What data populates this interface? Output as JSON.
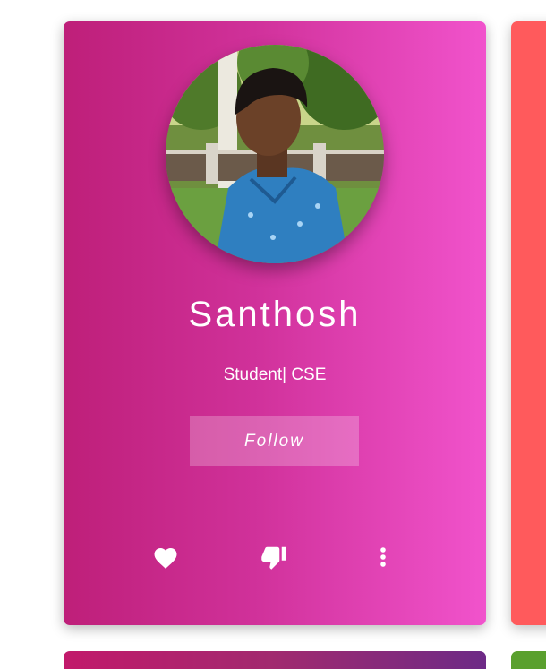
{
  "profile": {
    "name": "Santhosh",
    "role": "Student| CSE",
    "follow_label": "Follow",
    "avatar_alt": "Profile photo of Santhosh"
  },
  "actions": [
    {
      "icon": "heart-icon"
    },
    {
      "icon": "thumbs-down-icon"
    },
    {
      "icon": "more-vertical-icon"
    }
  ],
  "colors": {
    "card_gradient_start": "#be1f79",
    "card_gradient_end": "#f153cc",
    "neighbor_card": "#ff5a5c",
    "text": "#ffffff"
  }
}
